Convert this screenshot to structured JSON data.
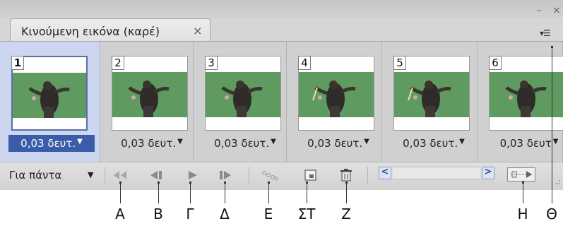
{
  "panel": {
    "tab_title": "Κινούμενη εικόνα (καρέ)",
    "close_glyph": "×",
    "minimize_glyph": "–",
    "window_close_glyph": "×",
    "menu_glyph": "▾☰"
  },
  "frames": [
    {
      "number": "1",
      "delay": "0,03 δευτ.",
      "selected": true
    },
    {
      "number": "2",
      "delay": "0,03 δευτ.",
      "selected": false
    },
    {
      "number": "3",
      "delay": "0,03 δευτ.",
      "selected": false
    },
    {
      "number": "4",
      "delay": "0,03 δευτ.",
      "selected": false
    },
    {
      "number": "5",
      "delay": "0,03 δευτ.",
      "selected": false
    },
    {
      "number": "6",
      "delay": "0,03 δευτ",
      "selected": false
    }
  ],
  "toolbar": {
    "loop_label": "Για πάντα",
    "dropdown_arrow": "▼",
    "scroll_left": "<",
    "scroll_right": ">"
  },
  "callouts": [
    "A",
    "B",
    "Γ",
    "Δ",
    "E",
    "ΣΤ",
    "Z",
    "H",
    "Θ"
  ],
  "icons": {
    "first_frame": "first-frame-icon",
    "previous_frame": "previous-frame-icon",
    "play": "play-icon",
    "next_frame": "next-frame-icon",
    "tween": "tween-icon",
    "duplicate": "duplicate-frame-icon",
    "delete": "delete-frame-icon",
    "convert_timeline": "convert-to-timeline-icon",
    "panel_menu": "panel-menu-icon"
  },
  "colors": {
    "selected_frame_bg": "#ccd6ef",
    "selected_delay_bg": "#3b5ca8",
    "thumbnail_green": "#5f9a60",
    "scroll_button": "#dde3f4"
  }
}
